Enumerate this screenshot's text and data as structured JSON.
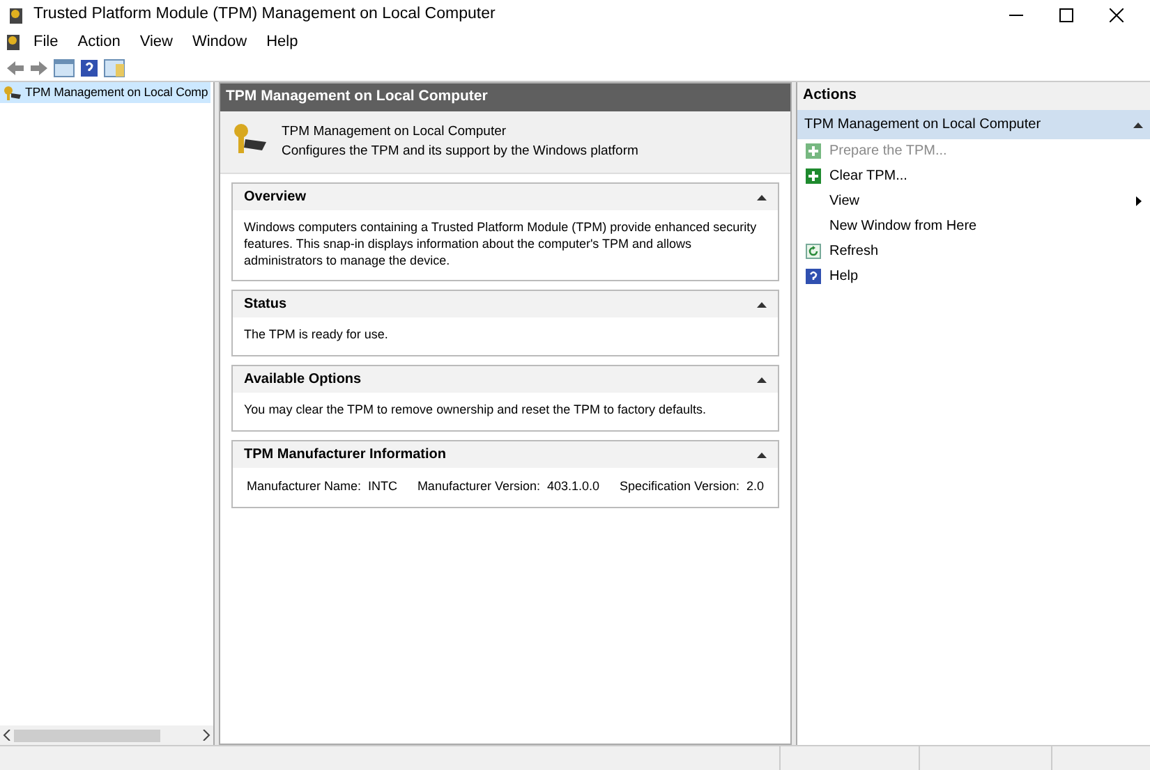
{
  "window": {
    "title": "Trusted Platform Module (TPM) Management on Local Computer"
  },
  "menu": [
    "File",
    "Action",
    "View",
    "Window",
    "Help"
  ],
  "tree": {
    "items": [
      {
        "label": "TPM Management on Local Comp",
        "selected": true
      }
    ]
  },
  "center": {
    "header": "TPM Management on Local Computer",
    "intro_title": "TPM Management on Local Computer",
    "intro_text": "Configures the TPM and its support by the Windows platform",
    "sections": [
      {
        "kind": "text",
        "title": "Overview",
        "expanded": true,
        "text": "Windows computers containing a Trusted Platform Module (TPM) provide enhanced security features. This snap-in displays information about the computer's TPM and allows administrators to manage the device."
      },
      {
        "kind": "text",
        "title": "Status",
        "expanded": true,
        "text": "The TPM is ready for use."
      },
      {
        "kind": "text",
        "title": "Available Options",
        "expanded": true,
        "text": "You may clear the TPM to remove ownership and reset the TPM to factory defaults."
      },
      {
        "kind": "fields",
        "title": "TPM Manufacturer Information",
        "expanded": true,
        "fields": [
          {
            "label": "Manufacturer Name:",
            "value": "INTC"
          },
          {
            "label": "Manufacturer Version:",
            "value": "403.1.0.0"
          },
          {
            "label": "Specification Version:",
            "value": "2.0"
          }
        ]
      }
    ]
  },
  "actions": {
    "title": "Actions",
    "group": "TPM Management on Local Computer",
    "group_expanded": true,
    "items": [
      {
        "kind": "add",
        "label": "Prepare the TPM...",
        "disabled": true
      },
      {
        "kind": "add",
        "label": "Clear TPM...",
        "disabled": false
      },
      {
        "kind": "submenu",
        "label": "View",
        "disabled": false
      },
      {
        "kind": "plain",
        "label": "New Window from Here",
        "disabled": false
      },
      {
        "kind": "refresh",
        "label": "Refresh",
        "disabled": false
      },
      {
        "kind": "help",
        "label": "Help",
        "disabled": false
      }
    ]
  }
}
